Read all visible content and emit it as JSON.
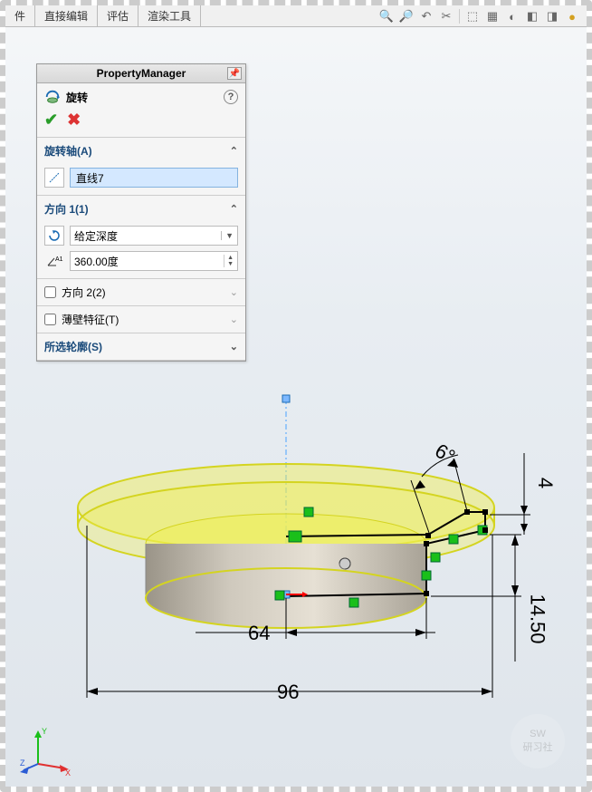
{
  "tabs": {
    "t0": "件",
    "t1": "直接编辑",
    "t2": "评估",
    "t3": "渲染工具"
  },
  "pm": {
    "title": "PropertyManager",
    "feature": "旋转",
    "section_axis": "旋转轴(A)",
    "axis_value": "直线7",
    "section_dir1": "方向 1(1)",
    "depth_type": "给定深度",
    "angle_value": "360.00度",
    "section_dir2": "方向 2(2)",
    "section_thin": "薄壁特征(T)",
    "section_contour": "所选轮廓(S)"
  },
  "dims": {
    "d64": "64",
    "d96": "96",
    "d6deg": "6°",
    "d4": "4",
    "d1450": "14.50"
  },
  "triad": {
    "x": "X",
    "y": "Y",
    "z": "Z"
  },
  "watermark": {
    "l1": "SW",
    "l2": "研习社"
  }
}
